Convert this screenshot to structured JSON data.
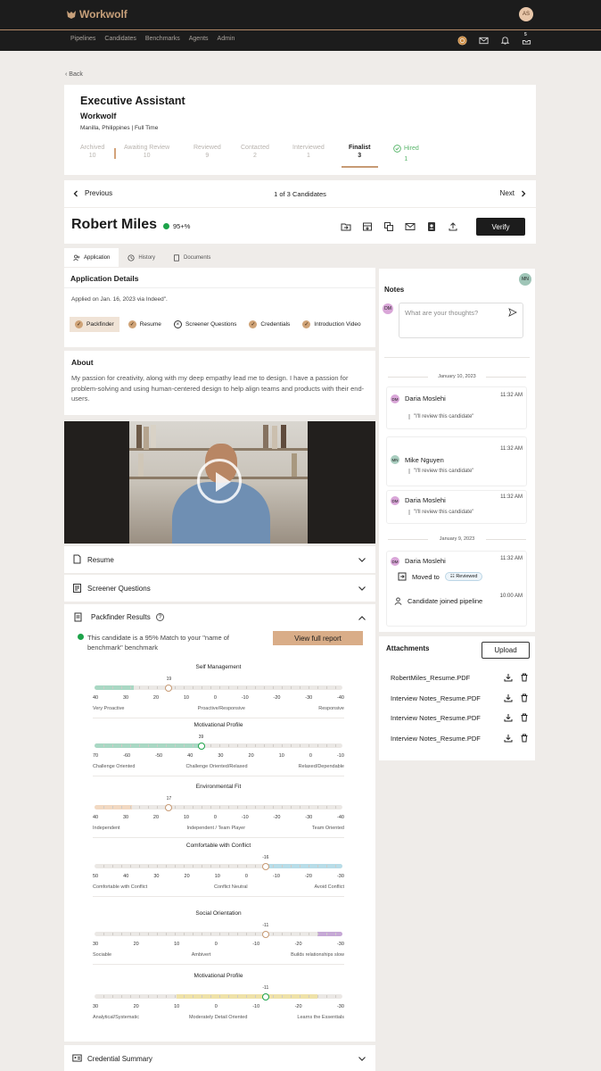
{
  "app": {
    "brand": "Workwolf",
    "user_initials": "AS"
  },
  "nav": {
    "items": [
      "Pipelines",
      "Candidates",
      "Benchmarks",
      "Agents",
      "Admin"
    ],
    "inbox_count": "5"
  },
  "back_label": "Back",
  "job": {
    "title": "Executive Assistant",
    "company": "Workwolf",
    "location": "Manilla, Philippines | Full Time",
    "stages": [
      {
        "label": "Archived",
        "count": "10"
      },
      {
        "label": "Awaiting Review",
        "count": "10"
      },
      {
        "label": "Reviewed",
        "count": "9"
      },
      {
        "label": "Contacted",
        "count": "2"
      },
      {
        "label": "Interviewed",
        "count": "1"
      },
      {
        "label": "Finalist",
        "count": "3"
      },
      {
        "label": "Hired",
        "count": "1"
      }
    ]
  },
  "pager": {
    "previous": "Previous",
    "position": "1 of 3 Candidates",
    "next": "Next"
  },
  "candidate": {
    "name": "Robert Miles",
    "match": "95+%",
    "verify_label": "Verify"
  },
  "tabs": [
    "Application",
    "History",
    "Documents"
  ],
  "application": {
    "title": "Application Details",
    "applied": "Applied on Jan. 16, 2023 via Indeed\".",
    "checks": [
      "Packfinder",
      "Resume",
      "Screener Questions",
      "Credentials",
      "Introduction Video"
    ]
  },
  "about": {
    "title": "About",
    "text": "My passion for creativity, along with my deep empathy lead me to design. I have a passion for problem-solving and using human-centered design to help align teams and products with their end-users."
  },
  "sections": {
    "resume": "Resume",
    "screener": "Screener Questions",
    "credential": "Credential Summary"
  },
  "packfinder": {
    "title": "Packfinder Results",
    "summary": "This candidate is a 95% Match to your \"name of benchmark\" benchmark",
    "view_report": "View full report",
    "colors": {
      "green": "#a9d8c4",
      "peach": "#f2d9c2",
      "blue": "#b8dde8",
      "purple": "#c6a8d6",
      "yellow": "#efe2a9"
    },
    "scales": [
      {
        "title": "Self Management",
        "value": "19",
        "ticks": [
          "40",
          "30",
          "20",
          "10",
          "0",
          "-10",
          "-20",
          "-30",
          "-40"
        ],
        "ends": [
          "Very Proactive",
          "Proactive/Responsive",
          "Responsive"
        ]
      },
      {
        "title": "Motivational Profile",
        "value": "39",
        "ticks": [
          "70",
          "-60",
          "-50",
          "40",
          "30",
          "20",
          "10",
          "0",
          "-10"
        ],
        "ends": [
          "Challenge Oriented",
          "Challenge Oriented/Relaxed",
          "Relaxed/Dependable"
        ]
      },
      {
        "title": "Environmental Fit",
        "value": "17",
        "ticks": [
          "40",
          "30",
          "20",
          "10",
          "0",
          "-10",
          "-20",
          "-30",
          "-40"
        ],
        "ends": [
          "Independent",
          "Independent / Team Player",
          "Team Oriented"
        ]
      },
      {
        "title": "Comfortable with Conflict",
        "value": "-16",
        "ticks": [
          "50",
          "40",
          "30",
          "20",
          "10",
          "0",
          "-10",
          "-20",
          "-30"
        ],
        "ends": [
          "Comfortable with Conflict",
          "Conflict Neutral",
          "Avoid Conflict"
        ]
      },
      {
        "title": "Social Orientation",
        "value": "-11",
        "ticks": [
          "30",
          "20",
          "10",
          "0",
          "-10",
          "-20",
          "-30"
        ],
        "ends": [
          "Sociable",
          "Ambivert",
          "Builds relationships slow"
        ]
      },
      {
        "title": "Motivational Profile",
        "value": "-11",
        "ticks": [
          "30",
          "20",
          "10",
          "0",
          "-10",
          "-20",
          "-30"
        ],
        "ends": [
          "Analytical/Systematic",
          "Moderately Detail Oriented",
          "Learns the Essentials"
        ]
      }
    ]
  },
  "notes": {
    "title": "Notes",
    "corner_avatar": "MN",
    "my_avatar": "DM",
    "placeholder": "What are your thoughts?",
    "date1": "January 10, 2023",
    "date2": "January 9, 2023",
    "entries": [
      {
        "initials": "DM",
        "name": "Daria Moslehi",
        "time": "11:32 AM",
        "msg": "\"I'll review this candidate\""
      },
      {
        "initials": "MN",
        "name": "Mike Nguyen",
        "time": "11:32 AM",
        "msg": "\"I'll review this candidate\""
      },
      {
        "initials": "DM",
        "name": "Daria Moslehi",
        "time": "11:32 AM",
        "msg": "\"I'll review this candidate\""
      },
      {
        "initials": "DM",
        "name": "Daria Moslehi",
        "time": "11:32 AM",
        "moved": "Moved to",
        "badge": "Reviewed"
      }
    ],
    "joined": {
      "time": "10:00 AM",
      "text": "Candidate joined pipeline"
    }
  },
  "attachments": {
    "title": "Attachments",
    "upload": "Upload",
    "files": [
      "RobertMiles_Resume.PDF",
      "Interview Notes_Resume.PDF",
      "Interview Notes_Resume.PDF",
      "Interview Notes_Resume.PDF"
    ]
  }
}
